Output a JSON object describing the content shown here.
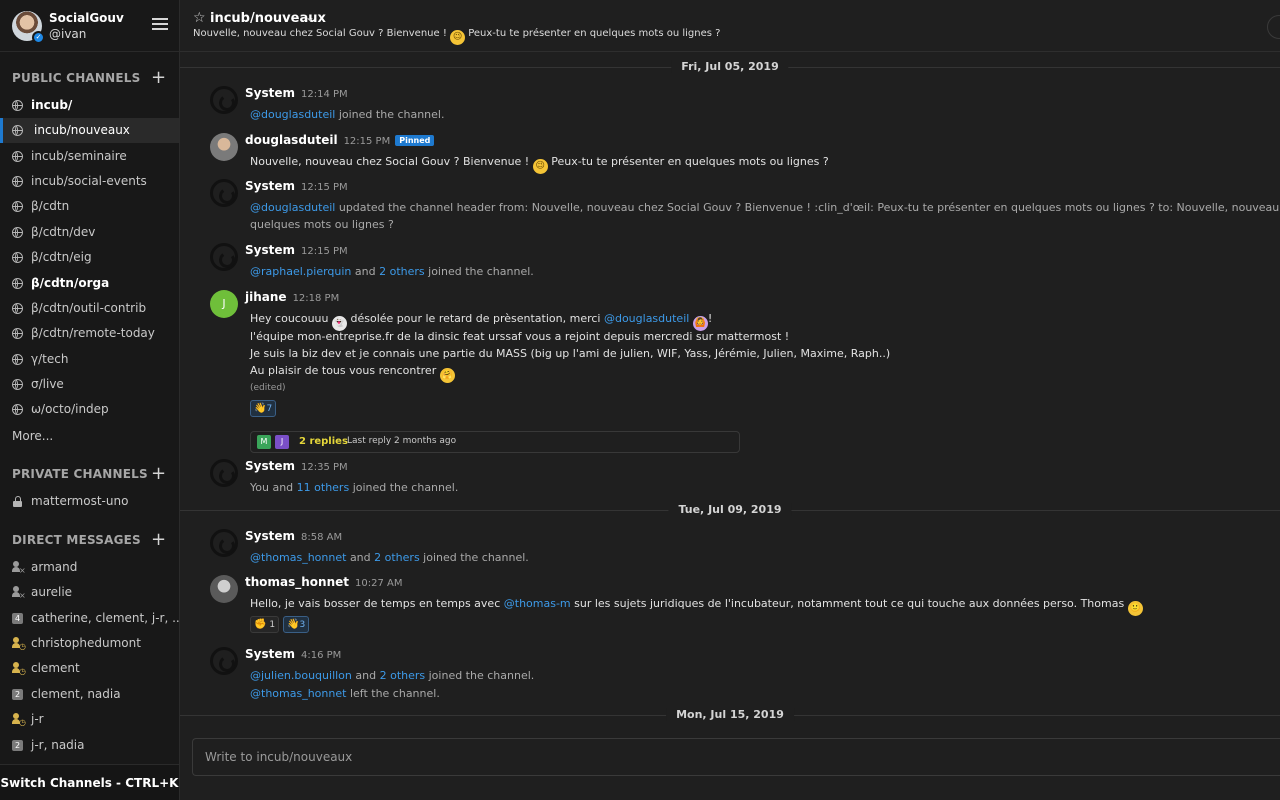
{
  "team": {
    "name": "SocialGouv",
    "user": "@ivan"
  },
  "sidebar": {
    "public_title": "PUBLIC CHANNELS",
    "public": [
      {
        "label": "incub/"
      },
      {
        "label": "incub/nouveaux"
      },
      {
        "label": "incub/seminaire"
      },
      {
        "label": "incub/social-events"
      },
      {
        "label": "β/cdtn"
      },
      {
        "label": "β/cdtn/dev"
      },
      {
        "label": "β/cdtn/eig"
      },
      {
        "label": "β/cdtn/orga"
      },
      {
        "label": "β/cdtn/outil-contrib"
      },
      {
        "label": "β/cdtn/remote-today"
      },
      {
        "label": "γ/tech"
      },
      {
        "label": "σ/live"
      },
      {
        "label": "ω/octo/indep"
      }
    ],
    "more": "More...",
    "private_title": "PRIVATE CHANNELS",
    "private": [
      {
        "label": "mattermost-uno"
      }
    ],
    "dm_title": "DIRECT MESSAGES",
    "dms": [
      {
        "label": "armand"
      },
      {
        "label": "aurelie"
      },
      {
        "label": "catherine, clement, j-r, ...",
        "badge": "4"
      },
      {
        "label": "christophedumont"
      },
      {
        "label": "clement"
      },
      {
        "label": "clement, nadia",
        "badge": "2"
      },
      {
        "label": "j-r"
      },
      {
        "label": "j-r, nadia",
        "badge": "2"
      }
    ],
    "switch": "Switch Channels - CTRL+K"
  },
  "header": {
    "title": "incub/nouveaux",
    "purpose_a": "Nouvelle, nouveau chez Social Gouv ? Bienvenue !",
    "purpose_b": "Peux-tu te présenter en quelques mots ou lignes ?",
    "emoji": "😉"
  },
  "dates": [
    "Fri, Jul 05, 2019",
    "Tue, Jul 09, 2019",
    "Mon, Jul 15, 2019"
  ],
  "messages": {
    "m1": {
      "name": "System",
      "time": "12:14 PM",
      "mention": "@douglasduteil",
      "text": "joined the channel."
    },
    "m2": {
      "name": "douglasduteil",
      "time": "12:15 PM",
      "pinned": "Pinned",
      "text_a": "Nouvelle, nouveau chez Social Gouv ? Bienvenue !",
      "text_b": "Peux-tu te présenter en quelques mots ou lignes ?",
      "emoji": "😉"
    },
    "m3": {
      "name": "System",
      "time": "12:15 PM",
      "mention": "@douglasduteil",
      "line1": "updated the channel header from: Nouvelle, nouveau chez Social Gouv ?  Bienvenue ! :clin_d'œil:  Peux-tu te présenter en quelques mots ou lignes ? to: Nouvelle, nouveau chez Social Gouv ? Bienvenue ! :clin_d'œil: Peux-tu te présenter en",
      "line2": "quelques mots ou lignes ?"
    },
    "m4": {
      "name": "System",
      "time": "12:15 PM",
      "mention": "@raphael.pierquin",
      "and": "and",
      "others": "2 others",
      "text": "joined the channel."
    },
    "m5": {
      "name": "jihane",
      "time": "12:18 PM",
      "l1a": "Hey coucouuu",
      "l1b": "désolée pour le retard de prèsentation, merci",
      "mention": "@douglasduteil",
      "l1c": "!",
      "ghost": "👻",
      "face": "🙆",
      "l2": "l'équipe mon-entreprise.fr de la dinsic feat urssaf vous a rejoint depuis mercredi sur mattermost !",
      "l3": "Je suis la biz dev et je connais une partie du MASS (big up l'ami de julien, WIF, Yass, Jérémie, Julien, Maxime, Raph..)",
      "l4": "Au plaisir de tous vous rencontrer",
      "hug": "🤗",
      "edited": "(edited)",
      "reaction_emoji": "👋",
      "reaction_count": "7",
      "thread_av1": "M",
      "thread_av2": "J",
      "replies": "2 replies",
      "last_reply": "Last reply 2 months ago"
    },
    "m6": {
      "name": "System",
      "time": "12:35 PM",
      "you": "You and",
      "others": "11 others",
      "text": "joined the channel."
    },
    "m7": {
      "name": "System",
      "time": "8:58 AM",
      "mention": "@thomas_honnet",
      "and": "and",
      "others": "2 others",
      "text": "joined the channel."
    },
    "m8": {
      "name": "thomas_honnet",
      "time": "10:27 AM",
      "a": "Hello, je vais bosser de temps en temps avec",
      "mention": "@thomas-m",
      "b": "sur les sujets juridiques de l'incubateur, notamment tout ce qui touche aux données perso. Thomas",
      "emoji": "🙂",
      "r1_emoji": "✊",
      "r1_count": "1",
      "r2_emoji": "👋",
      "r2_count": "3"
    },
    "m9": {
      "name": "System",
      "time": "4:16 PM",
      "mention": "@julien.bouquillon",
      "and": "and",
      "others": "2 others",
      "text": "joined the channel.",
      "mention2": "@thomas_honnet",
      "text2": "left the channel."
    }
  },
  "input": {
    "placeholder": "Write to incub/nouveaux"
  },
  "colors": {
    "accent": "#1e7ad0",
    "mention": "#3d9ae8",
    "replies": "#e4d63a"
  }
}
